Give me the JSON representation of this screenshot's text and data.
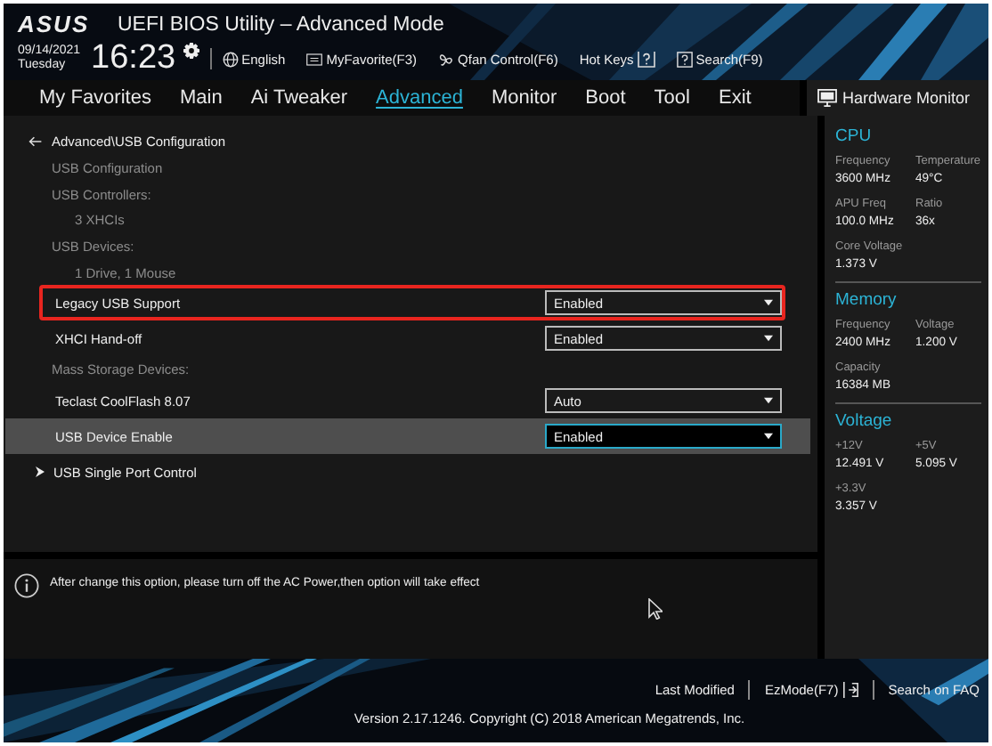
{
  "header": {
    "logo": "ASUS",
    "title": "UEFI BIOS Utility – Advanced Mode",
    "date": "09/14/2021",
    "day": "Tuesday",
    "time": "16:23",
    "tools": [
      {
        "kind": "globe",
        "label": "English"
      },
      {
        "kind": "favorite",
        "label": "MyFavorite(F3)"
      },
      {
        "kind": "fan",
        "label": "Qfan Control(F6)"
      },
      {
        "kind": "hotkeys",
        "label": "Hot Keys"
      },
      {
        "kind": "search",
        "label": "Search(F9)"
      }
    ]
  },
  "tabs": [
    {
      "label": "My Favorites",
      "selected": false
    },
    {
      "label": "Main",
      "selected": false
    },
    {
      "label": "Ai Tweaker",
      "selected": false
    },
    {
      "label": "Advanced",
      "selected": true
    },
    {
      "label": "Monitor",
      "selected": false
    },
    {
      "label": "Boot",
      "selected": false
    },
    {
      "label": "Tool",
      "selected": false
    },
    {
      "label": "Exit",
      "selected": false
    }
  ],
  "breadcrumb": "Advanced\\USB Configuration",
  "items": [
    {
      "kind": "label",
      "text": "USB Configuration"
    },
    {
      "kind": "label",
      "text": "USB Controllers:"
    },
    {
      "kind": "sub",
      "text": "3 XHCIs"
    },
    {
      "kind": "label",
      "text": "USB Devices:"
    },
    {
      "kind": "sub",
      "text": "1 Drive, 1 Mouse"
    },
    {
      "kind": "option",
      "text": "Legacy USB Support",
      "value": "Enabled",
      "selected": false,
      "highlighted": true
    },
    {
      "kind": "option",
      "text": "XHCI Hand-off",
      "value": "Enabled",
      "selected": false,
      "highlighted": false
    },
    {
      "kind": "label",
      "text": "Mass Storage Devices:"
    },
    {
      "kind": "option",
      "text": "Teclast CoolFlash 8.07",
      "value": "Auto",
      "selected": false,
      "highlighted": false
    },
    {
      "kind": "option",
      "text": "USB Device Enable",
      "value": "Enabled",
      "selected": true,
      "highlighted": false
    },
    {
      "kind": "submenu",
      "text": "USB Single Port Control"
    }
  ],
  "help": "After change this option, please turn off the AC Power,then option will take effect",
  "hardware_monitor": {
    "title": "Hardware Monitor",
    "sections": [
      {
        "title": "CPU",
        "metrics": [
          {
            "label": "Frequency",
            "value": "3600 MHz"
          },
          {
            "label": "Temperature",
            "value": "49°C"
          },
          {
            "label": "APU Freq",
            "value": "100.0 MHz"
          },
          {
            "label": "Ratio",
            "value": "36x"
          },
          {
            "label": "Core Voltage",
            "value": "1.373 V"
          }
        ]
      },
      {
        "title": "Memory",
        "metrics": [
          {
            "label": "Frequency",
            "value": "2400 MHz"
          },
          {
            "label": "Voltage",
            "value": "1.200 V"
          },
          {
            "label": "Capacity",
            "value": "16384 MB"
          }
        ]
      },
      {
        "title": "Voltage",
        "metrics": [
          {
            "label": "+12V",
            "value": "12.491 V"
          },
          {
            "label": "+5V",
            "value": "5.095 V"
          },
          {
            "label": "+3.3V",
            "value": "3.357 V"
          }
        ]
      }
    ]
  },
  "footer": {
    "links": [
      {
        "kind": "text",
        "label": "Last Modified"
      },
      {
        "kind": "ezmode",
        "label": "EzMode(F7)"
      },
      {
        "kind": "text",
        "label": "Search on FAQ"
      }
    ],
    "version": "Version 2.17.1246. Copyright (C) 2018 American Megatrends, Inc."
  }
}
